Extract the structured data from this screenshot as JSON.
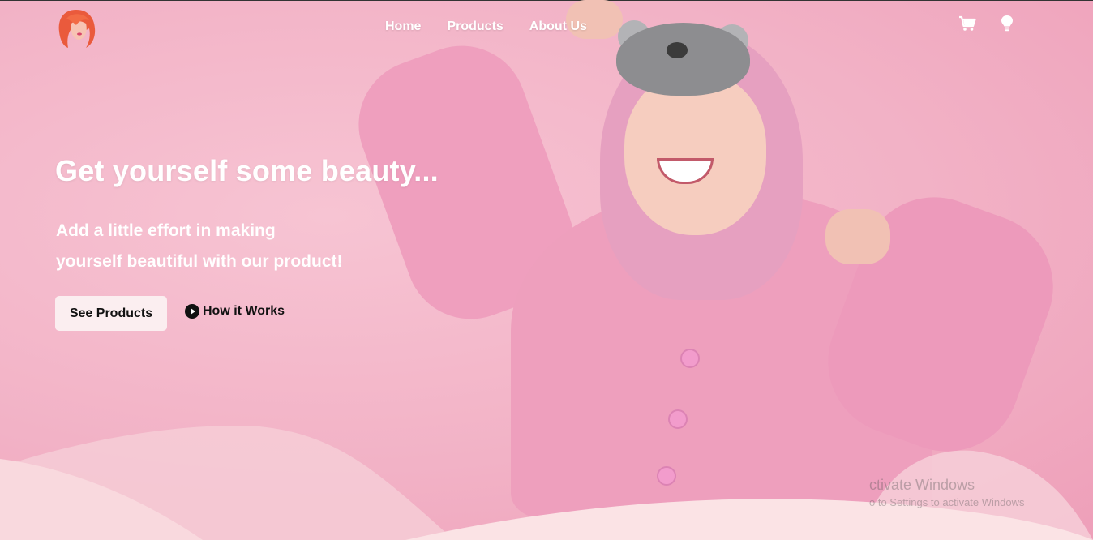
{
  "nav": {
    "items": [
      {
        "label": "Home"
      },
      {
        "label": "Products"
      },
      {
        "label": "About Us"
      }
    ],
    "icons": [
      "cart-icon",
      "lightbulb-icon"
    ]
  },
  "hero": {
    "headline": "Get yourself some beauty...",
    "subtitle_line1": "Add a little effort in making",
    "subtitle_line2": "yourself beautiful with our product!",
    "primary_button": "See Products",
    "secondary_link": "How it Works"
  },
  "watermark": {
    "line1": "ctivate Windows",
    "line2": "o to Settings to activate Windows"
  },
  "colors": {
    "background": "#f4b9cb",
    "accent_light": "#fbeef0",
    "text_light": "#ffffff",
    "text_dark": "#111111",
    "logo_hair": "#ea5a3c"
  }
}
